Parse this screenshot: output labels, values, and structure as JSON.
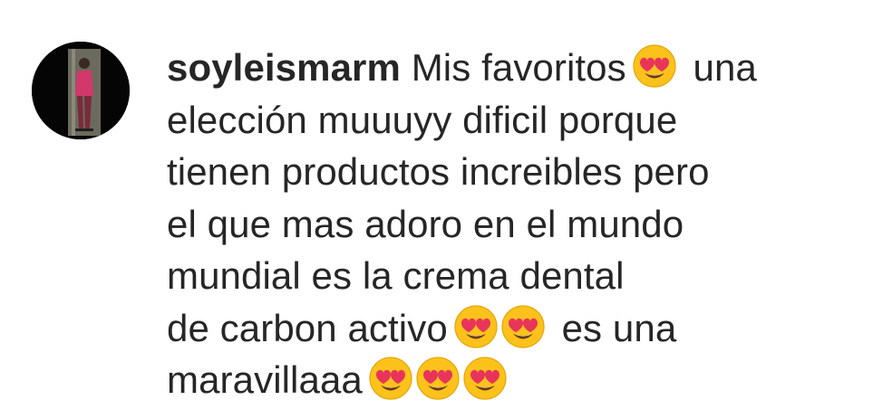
{
  "comment": {
    "username": "soyleismarm",
    "lines": [
      {
        "pre": "Mis favoritos",
        "emojis": 1,
        "post": "una"
      },
      {
        "text": "elección muuuyy dificil porque"
      },
      {
        "text": "tienen productos increibles pero"
      },
      {
        "text": "el que mas adoro en el mundo"
      },
      {
        "text": "mundial es la crema dental"
      },
      {
        "pre": "de carbon activo",
        "emojis": 2,
        "post": "es una"
      },
      {
        "pre": "maravillaaa",
        "emojis": 3,
        "post": ""
      }
    ],
    "emoji_name": "smiling-face-with-heart-eyes",
    "colors": {
      "text": "#262626",
      "emoji_face": "#fcc21b",
      "emoji_heart": "#e8345a"
    }
  }
}
